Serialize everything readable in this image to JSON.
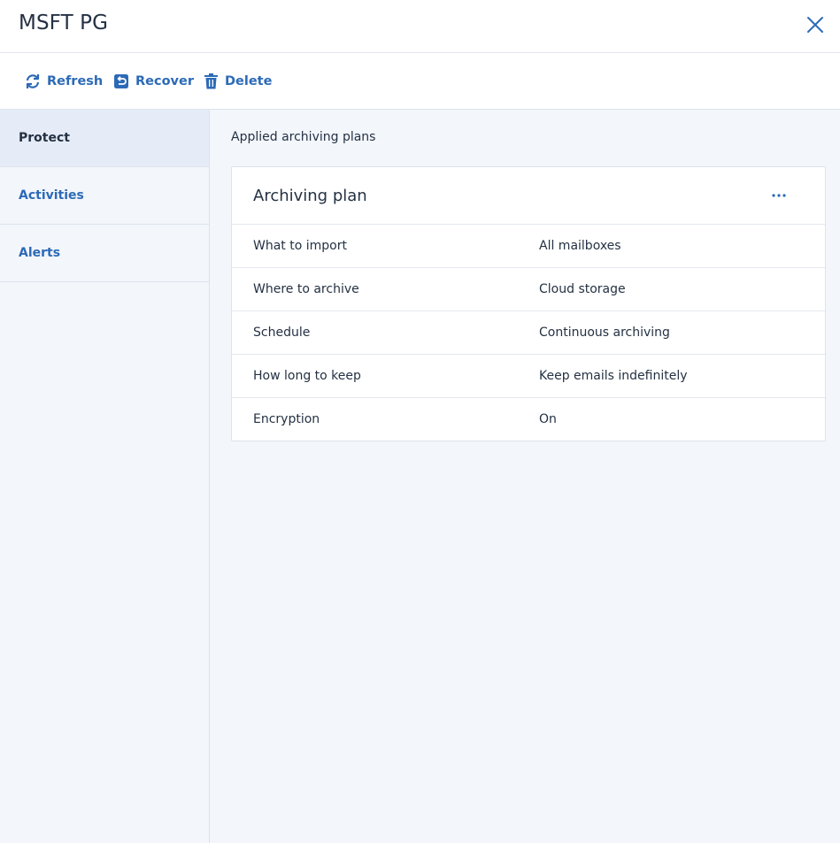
{
  "header": {
    "title": "MSFT PG",
    "close_icon": "close-icon"
  },
  "toolbar": {
    "refresh_label": "Refresh",
    "recover_label": "Recover",
    "delete_label": "Delete"
  },
  "sidebar": {
    "items": [
      {
        "label": "Protect",
        "active": true
      },
      {
        "label": "Activities",
        "active": false
      },
      {
        "label": "Alerts",
        "active": false
      }
    ]
  },
  "main": {
    "section_title": "Applied archiving plans",
    "plan": {
      "title": "Archiving plan",
      "rows": [
        {
          "key": "What to import",
          "value": "All mailboxes"
        },
        {
          "key": "Where to archive",
          "value": "Cloud storage"
        },
        {
          "key": "Schedule",
          "value": "Continuous archiving"
        },
        {
          "key": "How long to keep",
          "value": "Keep emails indefinitely"
        },
        {
          "key": "Encryption",
          "value": "On"
        }
      ]
    }
  },
  "colors": {
    "accent": "#2c6ab7",
    "text": "#243143",
    "sidebar_bg": "#f3f6fb",
    "active_bg": "#e6ecf7",
    "border": "#dde3eb"
  }
}
